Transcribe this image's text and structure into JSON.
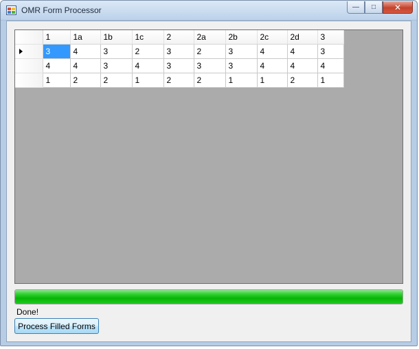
{
  "window": {
    "title": "OMR Form Processor",
    "minimize_glyph": "—",
    "maximize_glyph": "□",
    "close_glyph": "✕"
  },
  "grid": {
    "columns": [
      "1",
      "1a",
      "1b",
      "1c",
      "2",
      "2a",
      "2b",
      "2c",
      "2d",
      "3"
    ],
    "rows": [
      [
        "3",
        "4",
        "3",
        "2",
        "3",
        "2",
        "3",
        "4",
        "4",
        "3"
      ],
      [
        "4",
        "4",
        "3",
        "4",
        "3",
        "3",
        "3",
        "4",
        "4",
        "4"
      ],
      [
        "1",
        "2",
        "2",
        "1",
        "2",
        "2",
        "1",
        "1",
        "2",
        "1"
      ]
    ],
    "selected_cell": {
      "row": 0,
      "col": 0
    },
    "current_row": 0
  },
  "progress": {
    "value_percent": 100,
    "color": "#06b506"
  },
  "status": {
    "text": "Done!"
  },
  "actions": {
    "process_label": "Process Filled Forms"
  }
}
